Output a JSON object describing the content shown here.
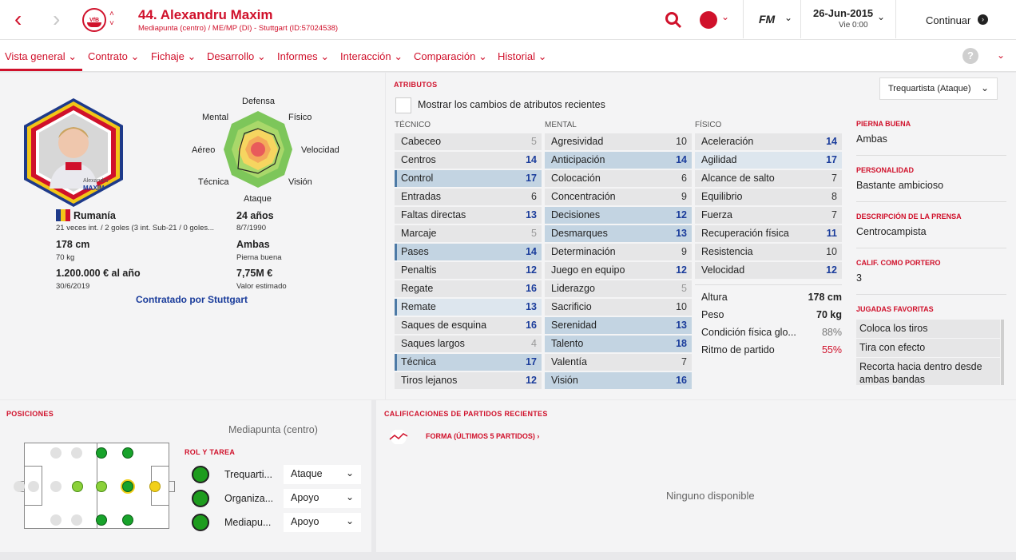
{
  "header": {
    "player_title": "44. Alexandru Maxim",
    "subtitle": "Mediapunta (centro) / ME/MP (DI) - Stuttgart (ID:57024538)",
    "club_badge_text": "VfB",
    "game_logo": "FM",
    "date": "26-Jun-2015",
    "day_time": "Vie 0:00",
    "continue_label": "Continuar"
  },
  "tabs": [
    "Vista general",
    "Contrato",
    "Fichaje",
    "Desarrollo",
    "Informes",
    "Interacción",
    "Comparación",
    "Historial"
  ],
  "profile": {
    "card_first_name": "Alexandru",
    "card_last_name": "MAXIM",
    "nation": "Rumanía",
    "caps": "21 veces int. / 2 goles (3 int. Sub-21 / 0 goles...",
    "age": "24 años",
    "birth_date": "8/7/1990",
    "height": "178 cm",
    "weight": "70 kg",
    "foot": "Ambas",
    "foot_label": "Pierna buena",
    "wage": "1.200.000 € al año",
    "contract_end": "30/6/2019",
    "value": "7,75M €",
    "value_label": "Valor estimado",
    "contracted_by": "Contratado por Stuttgart"
  },
  "radar": {
    "labels": {
      "defensa": "Defensa",
      "fisico": "Físico",
      "velocidad": "Velocidad",
      "vision": "Visión",
      "ataque": "Ataque",
      "tecnica": "Técnica",
      "aereo": "Aéreo",
      "mental": "Mental"
    }
  },
  "attributes": {
    "title": "ATRIBUTOS",
    "role_select": "Trequartista (Ataque)",
    "show_changes_label": "Mostrar los cambios de atributos recientes",
    "technical_header": "TÉCNICO",
    "mental_header": "MENTAL",
    "physical_header": "FÍSICO",
    "technical": [
      {
        "name": "Cabeceo",
        "value": "5"
      },
      {
        "name": "Centros",
        "value": "14"
      },
      {
        "name": "Control",
        "value": "17"
      },
      {
        "name": "Entradas",
        "value": "6"
      },
      {
        "name": "Faltas directas",
        "value": "13"
      },
      {
        "name": "Marcaje",
        "value": "5"
      },
      {
        "name": "Pases",
        "value": "14"
      },
      {
        "name": "Penaltis",
        "value": "12"
      },
      {
        "name": "Regate",
        "value": "16"
      },
      {
        "name": "Remate",
        "value": "13"
      },
      {
        "name": "Saques de esquina",
        "value": "16"
      },
      {
        "name": "Saques largos",
        "value": "4"
      },
      {
        "name": "Técnica",
        "value": "17"
      },
      {
        "name": "Tiros lejanos",
        "value": "12"
      }
    ],
    "mental": [
      {
        "name": "Agresividad",
        "value": "10"
      },
      {
        "name": "Anticipación",
        "value": "14"
      },
      {
        "name": "Colocación",
        "value": "6"
      },
      {
        "name": "Concentración",
        "value": "9"
      },
      {
        "name": "Decisiones",
        "value": "12"
      },
      {
        "name": "Desmarques",
        "value": "13"
      },
      {
        "name": "Determinación",
        "value": "9"
      },
      {
        "name": "Juego en equipo",
        "value": "12"
      },
      {
        "name": "Liderazgo",
        "value": "5"
      },
      {
        "name": "Sacrificio",
        "value": "10"
      },
      {
        "name": "Serenidad",
        "value": "13"
      },
      {
        "name": "Talento",
        "value": "18"
      },
      {
        "name": "Valentía",
        "value": "7"
      },
      {
        "name": "Visión",
        "value": "16"
      }
    ],
    "physical": [
      {
        "name": "Aceleración",
        "value": "14"
      },
      {
        "name": "Agilidad",
        "value": "17"
      },
      {
        "name": "Alcance de salto",
        "value": "7"
      },
      {
        "name": "Equilibrio",
        "value": "8"
      },
      {
        "name": "Fuerza",
        "value": "7"
      },
      {
        "name": "Recuperación física",
        "value": "11"
      },
      {
        "name": "Resistencia",
        "value": "10"
      },
      {
        "name": "Velocidad",
        "value": "12"
      }
    ],
    "physical_extra": [
      {
        "name": "Altura",
        "value": "178 cm"
      },
      {
        "name": "Peso",
        "value": "70 kg"
      },
      {
        "name": "Condición física glo...",
        "value": "88%"
      },
      {
        "name": "Ritmo de partido",
        "value": "55%"
      }
    ]
  },
  "side_info": {
    "foot_h": "PIERNA BUENA",
    "foot_v": "Ambas",
    "personality_h": "PERSONALIDAD",
    "personality_v": "Bastante ambicioso",
    "press_h": "DESCRIPCIÓN DE LA PRENSA",
    "press_v": "Centrocampista",
    "gk_h": "CALIF. COMO PORTERO",
    "gk_v": "3",
    "moves_h": "JUGADAS FAVORITAS",
    "moves": [
      "Coloca los tiros",
      "Tira con efecto",
      "Recorta hacia dentro desde ambas bandas"
    ]
  },
  "positions": {
    "title": "POSICIONES",
    "main_position": "Mediapunta (centro)",
    "role_title": "ROL Y TAREA",
    "roles": [
      {
        "name": "Trequarti...",
        "duty": "Ataque"
      },
      {
        "name": "Organiza...",
        "duty": "Apoyo"
      },
      {
        "name": "Mediapu...",
        "duty": "Apoyo"
      }
    ]
  },
  "recent": {
    "title": "CALIFICACIONES DE PARTIDOS RECIENTES",
    "form_label": "FORMA (ÚLTIMOS 5 PARTIDOS)",
    "empty": "Ninguno disponible"
  }
}
